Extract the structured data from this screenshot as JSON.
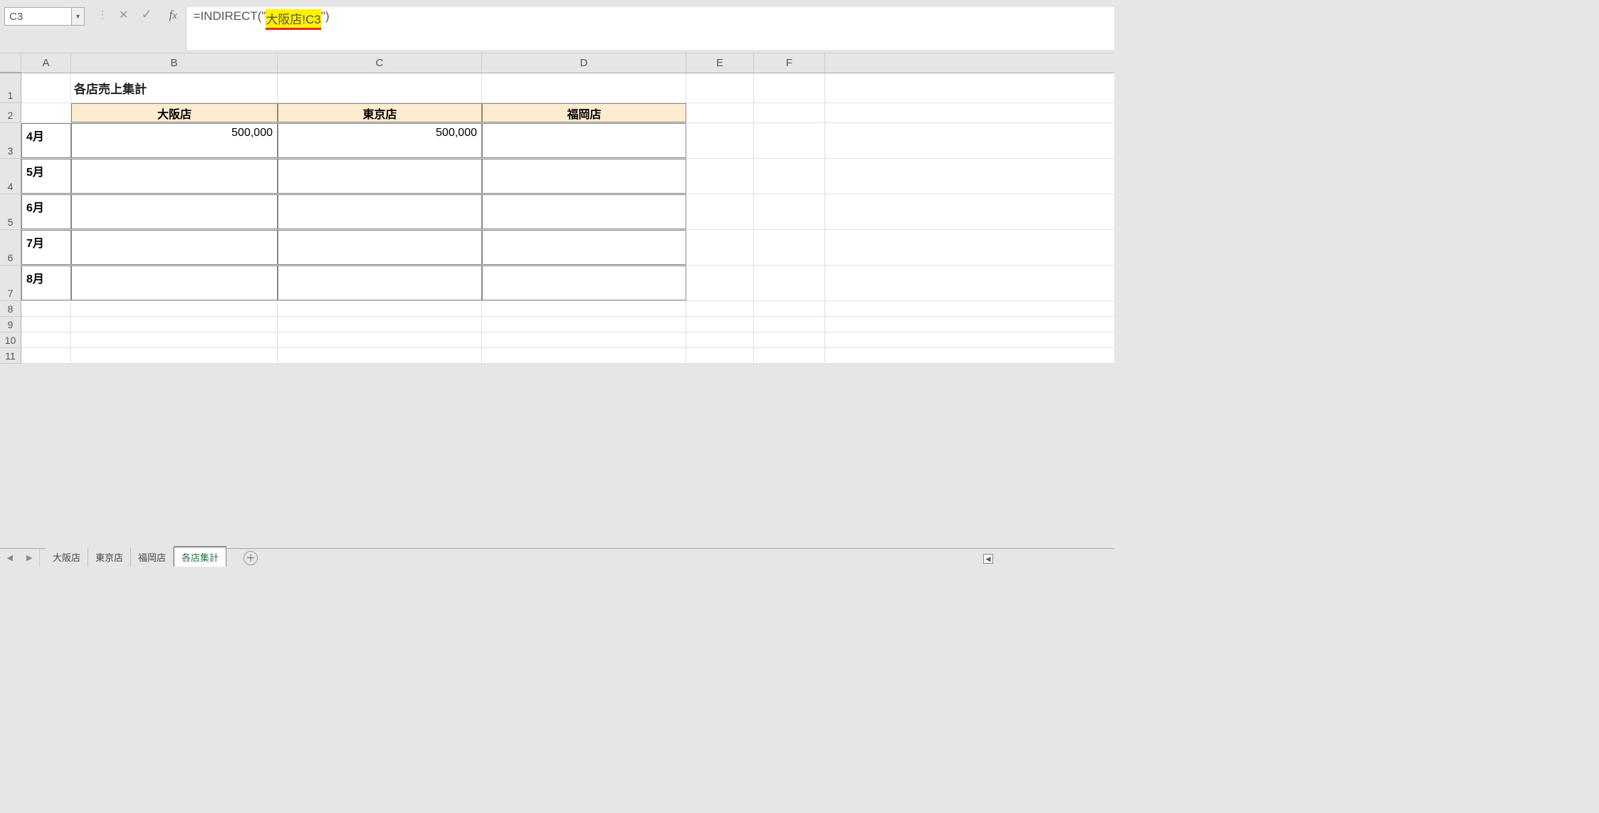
{
  "name_box": "C3",
  "formula": {
    "prefix": "=INDIRECT(\"",
    "highlight": "大阪店!C3",
    "suffix": "\")"
  },
  "columns": [
    "A",
    "B",
    "C",
    "D",
    "E",
    "F"
  ],
  "row_numbers": [
    "1",
    "2",
    "3",
    "4",
    "5",
    "6",
    "7",
    "8",
    "9",
    "10",
    "11"
  ],
  "title": "各店売上集計",
  "table": {
    "headers": [
      "大阪店",
      "東京店",
      "福岡店"
    ],
    "rows": [
      {
        "label": "4月",
        "values": [
          "500,000",
          "500,000",
          ""
        ]
      },
      {
        "label": "5月",
        "values": [
          "",
          "",
          ""
        ]
      },
      {
        "label": "6月",
        "values": [
          "",
          "",
          ""
        ]
      },
      {
        "label": "7月",
        "values": [
          "",
          "",
          ""
        ]
      },
      {
        "label": "8月",
        "values": [
          "",
          "",
          ""
        ]
      }
    ]
  },
  "sheet_tabs": [
    "大阪店",
    "東京店",
    "福岡店",
    "各店集計"
  ],
  "active_tab": "各店集計",
  "row_heights": {
    "r1": 42,
    "r2": 28,
    "r3": 50,
    "r4": 50,
    "r5": 50,
    "r6": 50,
    "r7": 50,
    "r8": 22,
    "r9": 22,
    "r10": 22,
    "r11": 22
  }
}
